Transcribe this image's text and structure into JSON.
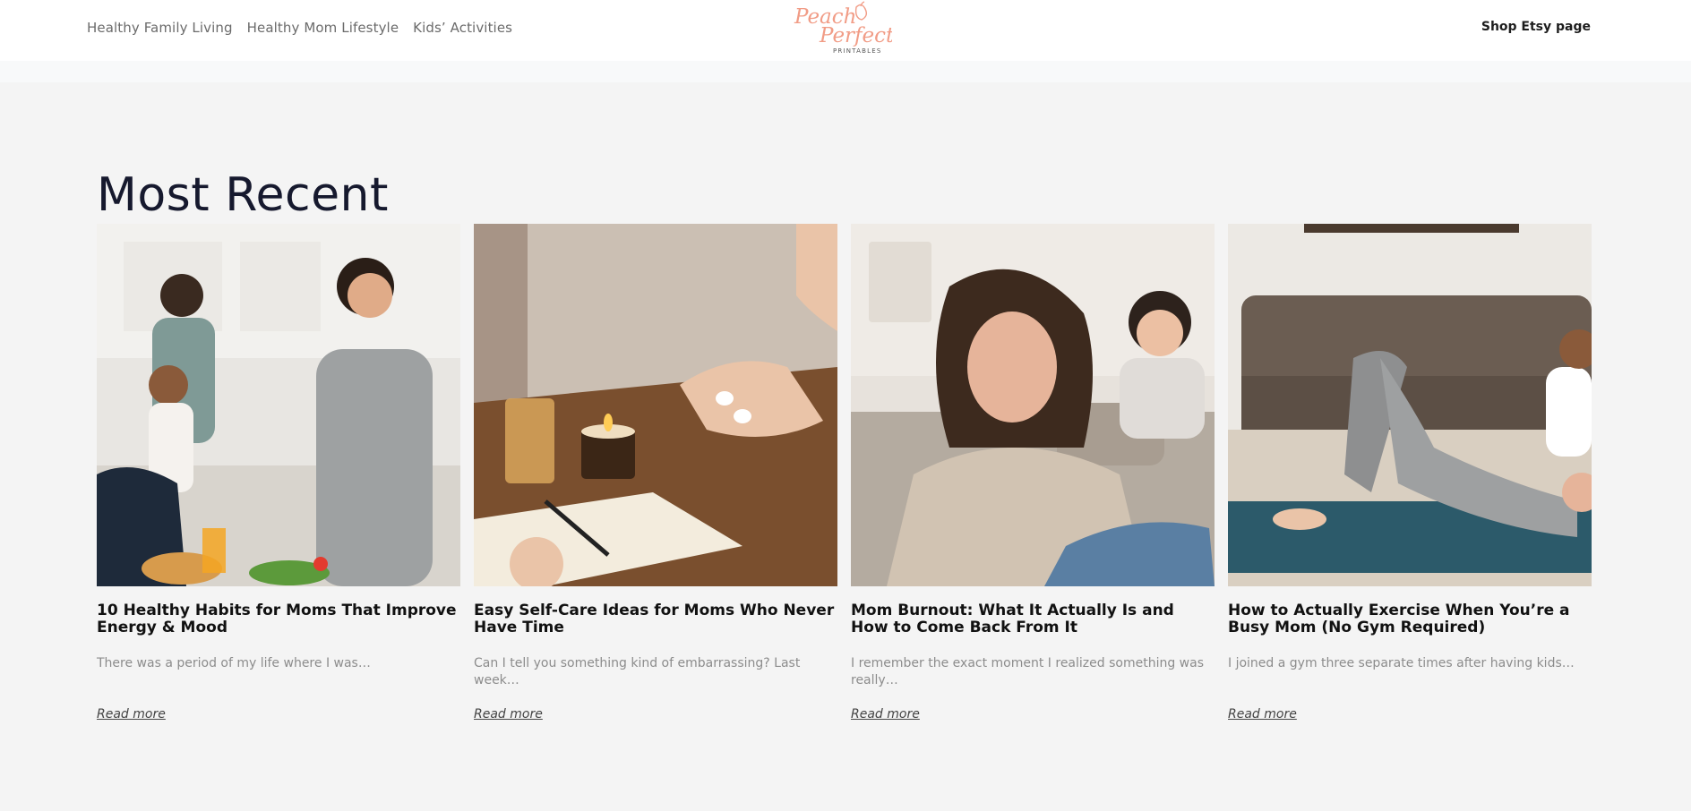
{
  "nav": {
    "links": [
      "Healthy Family Living",
      "Healthy Mom Lifestyle",
      "Kids’ Activities"
    ],
    "shop_label": "Shop Etsy page"
  },
  "logo": {
    "line1": "Peach",
    "line2": "Perfect",
    "line3": "PRINTABLES",
    "color": "#f19c86"
  },
  "section": {
    "title": "Most Recent"
  },
  "posts": [
    {
      "title": "10 Healthy Habits for Moms That Improve Energy & Mood",
      "excerpt": "There was a period of my life where I was…",
      "read_more": "Read more",
      "image_icon": "family-kitchen-photo"
    },
    {
      "title": "Easy Self-Care Ideas for Moms Who Never Have Time",
      "excerpt": "Can I tell you something kind of embarrassing? Last week…",
      "read_more": "Read more",
      "image_icon": "self-care-candle-photo"
    },
    {
      "title": "Mom Burnout: What It Actually Is and How to Come Back From It",
      "excerpt": "I remember the exact moment I realized something was really…",
      "read_more": "Read more",
      "image_icon": "tired-mom-photo"
    },
    {
      "title": "How to Actually Exercise When You’re a Busy Mom (No Gym Required)",
      "excerpt": "I joined a gym three separate times after having kids…",
      "read_more": "Read more",
      "image_icon": "home-exercise-photo"
    }
  ],
  "colors": {
    "page_bg": "#f4f4f4",
    "header_bg": "#ffffff",
    "title": "#16192e",
    "excerpt": "#8c8c8c"
  }
}
